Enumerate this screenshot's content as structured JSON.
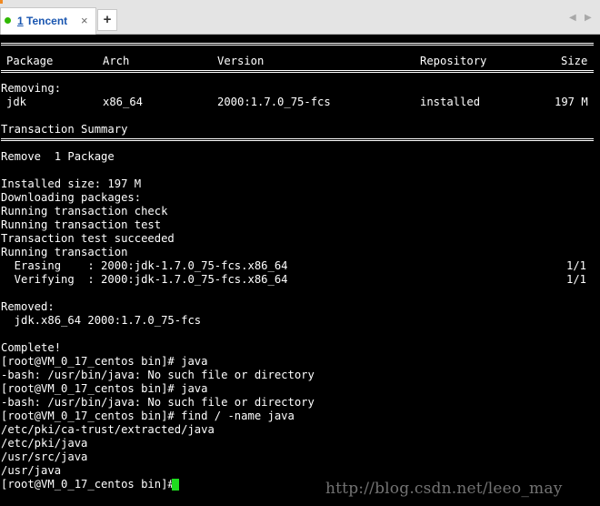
{
  "tabbar": {
    "tab": {
      "number": "1",
      "title": "Tencent",
      "close": "×",
      "status_color": "#2fb800"
    },
    "new_tab": "+",
    "nav_prev": "◀",
    "nav_next": "▶"
  },
  "terminal": {
    "header": {
      "package": "Package",
      "arch": "Arch",
      "version": "Version",
      "repository": "Repository",
      "size": "Size"
    },
    "removing_label": "Removing:",
    "row": {
      "package": "jdk",
      "arch": "x86_64",
      "version": "2000:1.7.0_75-fcs",
      "repository": "installed",
      "size": "197 M"
    },
    "summary_title": "Transaction Summary",
    "remove_line": "Remove  1 Package",
    "installed_size": "Installed size: 197 M",
    "downloading": "Downloading packages:",
    "running_check": "Running transaction check",
    "running_test": "Running transaction test",
    "test_succeeded": "Transaction test succeeded",
    "running_transaction": "Running transaction",
    "erasing": {
      "label": "  Erasing    : 2000:jdk-1.7.0_75-fcs.x86_64",
      "progress": "1/1"
    },
    "verifying": {
      "label": "  Verifying  : 2000:jdk-1.7.0_75-fcs.x86_64",
      "progress": "1/1"
    },
    "removed_label": "Removed:",
    "removed_item": "  jdk.x86_64 2000:1.7.0_75-fcs",
    "complete": "Complete!",
    "cmd1": "[root@VM_0_17_centos bin]# java",
    "err1": "-bash: /usr/bin/java: No such file or directory",
    "cmd2": "[root@VM_0_17_centos bin]# java",
    "err2": "-bash: /usr/bin/java: No such file or directory",
    "cmd3": "[root@VM_0_17_centos bin]# find / -name java",
    "result1": "/etc/pki/ca-trust/extracted/java",
    "result2": "/etc/pki/java",
    "result3": "/usr/src/java",
    "result4": "/usr/java",
    "prompt": "[root@VM_0_17_centos bin]# ",
    "cursor_color": "#1fdc1f"
  },
  "watermark": "http://blog.csdn.net/leeo_may"
}
